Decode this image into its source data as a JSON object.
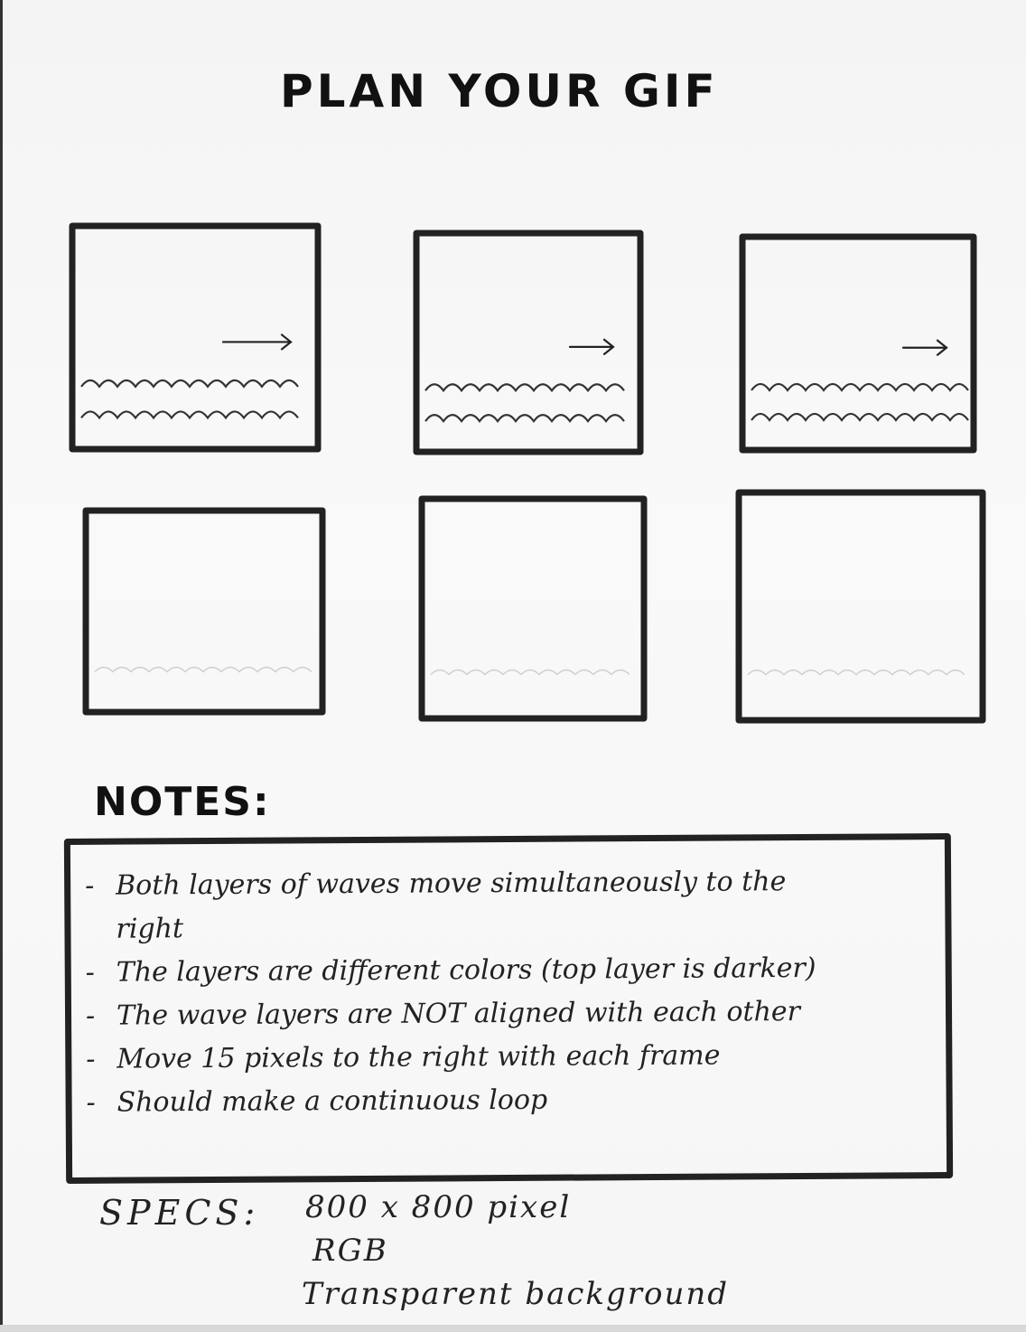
{
  "page": {
    "title": "PLAN YOUR GIF"
  },
  "frames": [
    {
      "content": "waves",
      "arrow": "right"
    },
    {
      "content": "waves",
      "arrow": "right"
    },
    {
      "content": "waves",
      "arrow": "right"
    },
    {
      "content": "empty"
    },
    {
      "content": "empty"
    },
    {
      "content": "empty"
    }
  ],
  "notes": {
    "heading": "NOTES:",
    "items": [
      "Both layers of waves move simultaneously to the right",
      "The layers are different colors (top layer is darker)",
      "The wave layers are NOT aligned with each other",
      "Move 15 pixels to the right with each frame",
      "Should make a continuous loop"
    ]
  },
  "specs": {
    "label": "SPECS:",
    "values": [
      "800 x 800 pixel",
      "RGB",
      "Transparent background"
    ]
  }
}
